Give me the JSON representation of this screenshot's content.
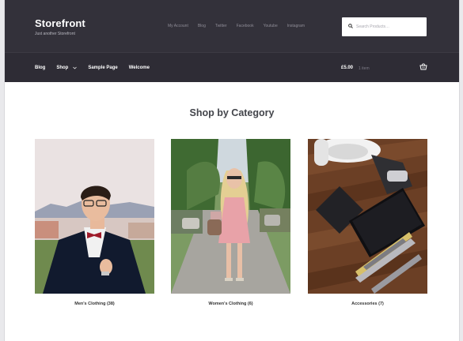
{
  "site": {
    "title": "Storefront",
    "tagline": "Just another Storefront"
  },
  "top_links": [
    "My Account",
    "Blog",
    "Twitter",
    "Facebook",
    "Youtube",
    "Instagram"
  ],
  "search": {
    "placeholder": "Search Products…",
    "icon": "search-icon"
  },
  "nav": {
    "items": [
      "Blog",
      "Shop",
      "Sample Page",
      "Welcome"
    ]
  },
  "cart": {
    "total": "£5.00",
    "count": "1 item",
    "icon": "basket-icon"
  },
  "section": {
    "title": "Shop by Category"
  },
  "categories": [
    {
      "name": "Men's Clothing",
      "count": "(38)"
    },
    {
      "name": "Women's Clothing",
      "count": "(6)"
    },
    {
      "name": "Accessories",
      "count": "(7)"
    }
  ],
  "colors": {
    "header": "#33313a",
    "navbar": "#2e2c35",
    "page": "#ffffff"
  }
}
